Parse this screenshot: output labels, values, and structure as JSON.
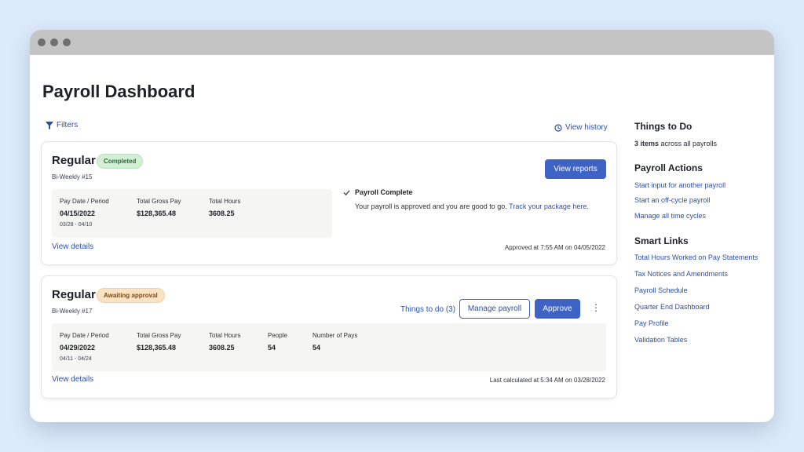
{
  "page": {
    "title": "Payroll Dashboard",
    "filters_label": "Filters",
    "history_label": "View history"
  },
  "payrolls": [
    {
      "title": "Regular",
      "status": "Completed",
      "subtitle": "Bi-Weekly #15",
      "action_label": "View reports",
      "stats": {
        "pay_date_label": "Pay Date / Period",
        "pay_date": "04/15/2022",
        "period": "03/28 - 04/10",
        "gross_label": "Total Gross Pay",
        "gross": "$128,365.48",
        "hours_label": "Total Hours",
        "hours": "3608.25"
      },
      "complete_title": "Payroll Complete",
      "complete_text": "Your payroll is approved and you are good to go.",
      "complete_link": "Track your package here.",
      "details_label": "View details",
      "footer": "Approved at 7:55 AM on 04/05/2022"
    },
    {
      "title": "Regular",
      "status": "Awaiting approval",
      "subtitle": "Bi-Weekly #17",
      "things_label": "Things to do (3)",
      "manage_label": "Manage payroll",
      "approve_label": "Approve",
      "stats": {
        "pay_date_label": "Pay Date / Period",
        "pay_date": "04/29/2022",
        "period": "04/11 - 04/24",
        "gross_label": "Total Gross Pay",
        "gross": "$128,365.48",
        "hours_label": "Total Hours",
        "hours": "3608.25",
        "people_label": "People",
        "people": "54",
        "pays_label": "Number of Pays",
        "pays": "54"
      },
      "details_label": "View details",
      "footer": "Last calculated at 5:34 AM on 03/28/2022"
    }
  ],
  "sidebar": {
    "todo_title": "Things to Do",
    "todo_count": "3 items",
    "todo_suffix": " across all payrolls",
    "actions_title": "Payroll Actions",
    "actions": [
      "Start input for another payroll",
      "Start an off-cycle payroll",
      "Manage all time cycles"
    ],
    "links_title": "Smart Links",
    "links": [
      "Total Hours Worked on Pay Statements",
      "Tax Notices and Amendments",
      "Payroll Schedule",
      "Quarter End Dashboard",
      "Pay Profile",
      "Validation Tables"
    ]
  },
  "colors": {
    "accent": "#3f63c4",
    "link": "#2e50a3",
    "completed_badge": "#d3efd6",
    "awaiting_badge": "#fbe2c4",
    "background": "#dcebfb"
  },
  "icons": {
    "filters": "funnel-icon",
    "history": "history-icon",
    "complete": "check-icon",
    "more": "kebab-icon"
  }
}
